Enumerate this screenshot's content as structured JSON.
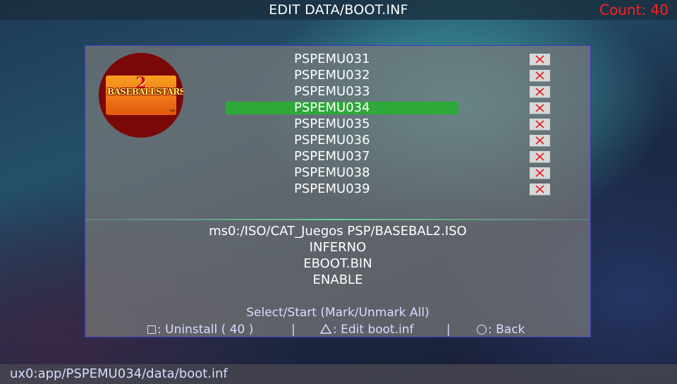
{
  "header": {
    "title": "EDIT DATA/BOOT.INF",
    "count_label": "Count: 40"
  },
  "game_icon": {
    "name": "baseball-stars-2-icon",
    "logo_text": "BASEBALLSTARS",
    "logo_number": "2",
    "tm": "TM"
  },
  "list": {
    "selected_index": 3,
    "items": [
      {
        "name": "PSPEMU031",
        "marked": true
      },
      {
        "name": "PSPEMU032",
        "marked": true
      },
      {
        "name": "PSPEMU033",
        "marked": true
      },
      {
        "name": "PSPEMU034",
        "marked": true
      },
      {
        "name": "PSPEMU035",
        "marked": true
      },
      {
        "name": "PSPEMU036",
        "marked": true
      },
      {
        "name": "PSPEMU037",
        "marked": true
      },
      {
        "name": "PSPEMU038",
        "marked": true
      },
      {
        "name": "PSPEMU039",
        "marked": true
      }
    ]
  },
  "details": {
    "iso_path": "ms0:/ISO/CAT_Juegos PSP/BASEBAL2.ISO",
    "driver": "INFERNO",
    "executable": "EBOOT.BIN",
    "state": "ENABLE"
  },
  "footer": {
    "hint": "Select/Start (Mark/Unmark All)",
    "uninstall": ": Uninstall ( 40 )",
    "sep1": "|",
    "edit": ": Edit boot.inf",
    "sep2": "|",
    "back": ": Back"
  },
  "status": {
    "path": "ux0:app/PSPEMU034/data/boot.inf"
  },
  "colors": {
    "count": "#ff2020",
    "selection": "#2fa83a",
    "panel_border": "#3a3ac8",
    "mark_x": "#e01818"
  },
  "icons": [
    "square-button-icon",
    "triangle-button-icon",
    "circle-button-icon",
    "close-x-icon"
  ]
}
